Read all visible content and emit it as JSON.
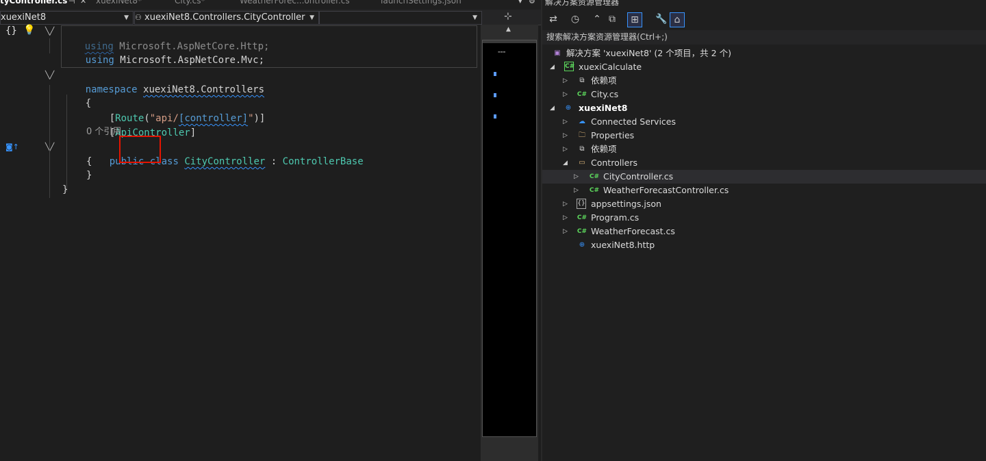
{
  "tabs": [
    {
      "label": "tyController.cs",
      "active": true
    },
    {
      "label": "xuexiNet8*"
    },
    {
      "label": "City.cs*"
    },
    {
      "label": "WeatherForec...ontroller.cs"
    },
    {
      "label": "launchSettings.json"
    }
  ],
  "tab_pin_icon": "pin-icon",
  "tab_close": "✕",
  "navbar": {
    "project": "xuexiNet8",
    "class": "xuexiNet8.Controllers.CityController",
    "member": ""
  },
  "code": {
    "l1_kw": "using",
    "l1_ns": " Microsoft.AspNetCore.Http;",
    "l2_kw": "using",
    "l2_ns": " Microsoft.AspNetCore.Mvc;",
    "l4_kw": "namespace",
    "l4_ns": "xuexiNet8.Controllers",
    "l5": "{",
    "l6_a": "[",
    "l6_route": "Route",
    "l6_b": "(",
    "l6_s1": "\"api/",
    "l6_ctrl": "[controller]",
    "l6_s2": "\"",
    "l6_c": ")]",
    "l7_a": "[",
    "l7_attr": "ApiController",
    "l7_b": "]",
    "l8": "0 个引用",
    "l9_pub": "public",
    "l9_class": "class",
    "l9_name": "CityController",
    "l9_colon": " : ",
    "l9_base": "ControllerBase",
    "l10": "{",
    "l11": "}",
    "l12": "}"
  },
  "solution_explorer": {
    "title": "解决方案资源管理器",
    "search_placeholder": "搜索解决方案资源管理器(Ctrl+;)",
    "items": [
      {
        "label": "解决方案 'xuexiNet8' (2 个项目，共 2 个)",
        "icon": "solution-icon"
      },
      {
        "label": "xuexiCalculate",
        "icon": "csharp-project-icon"
      },
      {
        "label": "依赖项",
        "icon": "dependencies-icon"
      },
      {
        "label": "City.cs",
        "icon": "csharp-file-icon"
      },
      {
        "label": "xuexiNet8",
        "icon": "web-project-icon"
      },
      {
        "label": "Connected Services",
        "icon": "connected-services-icon"
      },
      {
        "label": "Properties",
        "icon": "properties-icon"
      },
      {
        "label": "依赖项",
        "icon": "dependencies-icon"
      },
      {
        "label": "Controllers",
        "icon": "folder-icon"
      },
      {
        "label": "CityController.cs",
        "icon": "csharp-file-icon"
      },
      {
        "label": "WeatherForecastController.cs",
        "icon": "csharp-file-icon"
      },
      {
        "label": "appsettings.json",
        "icon": "json-file-icon"
      },
      {
        "label": "Program.cs",
        "icon": "csharp-file-icon"
      },
      {
        "label": "WeatherForecast.cs",
        "icon": "csharp-file-icon"
      },
      {
        "label": "xuexiNet8.http",
        "icon": "http-file-icon"
      }
    ],
    "cs_glyph": "C#"
  },
  "highlight_color": "#e51400"
}
